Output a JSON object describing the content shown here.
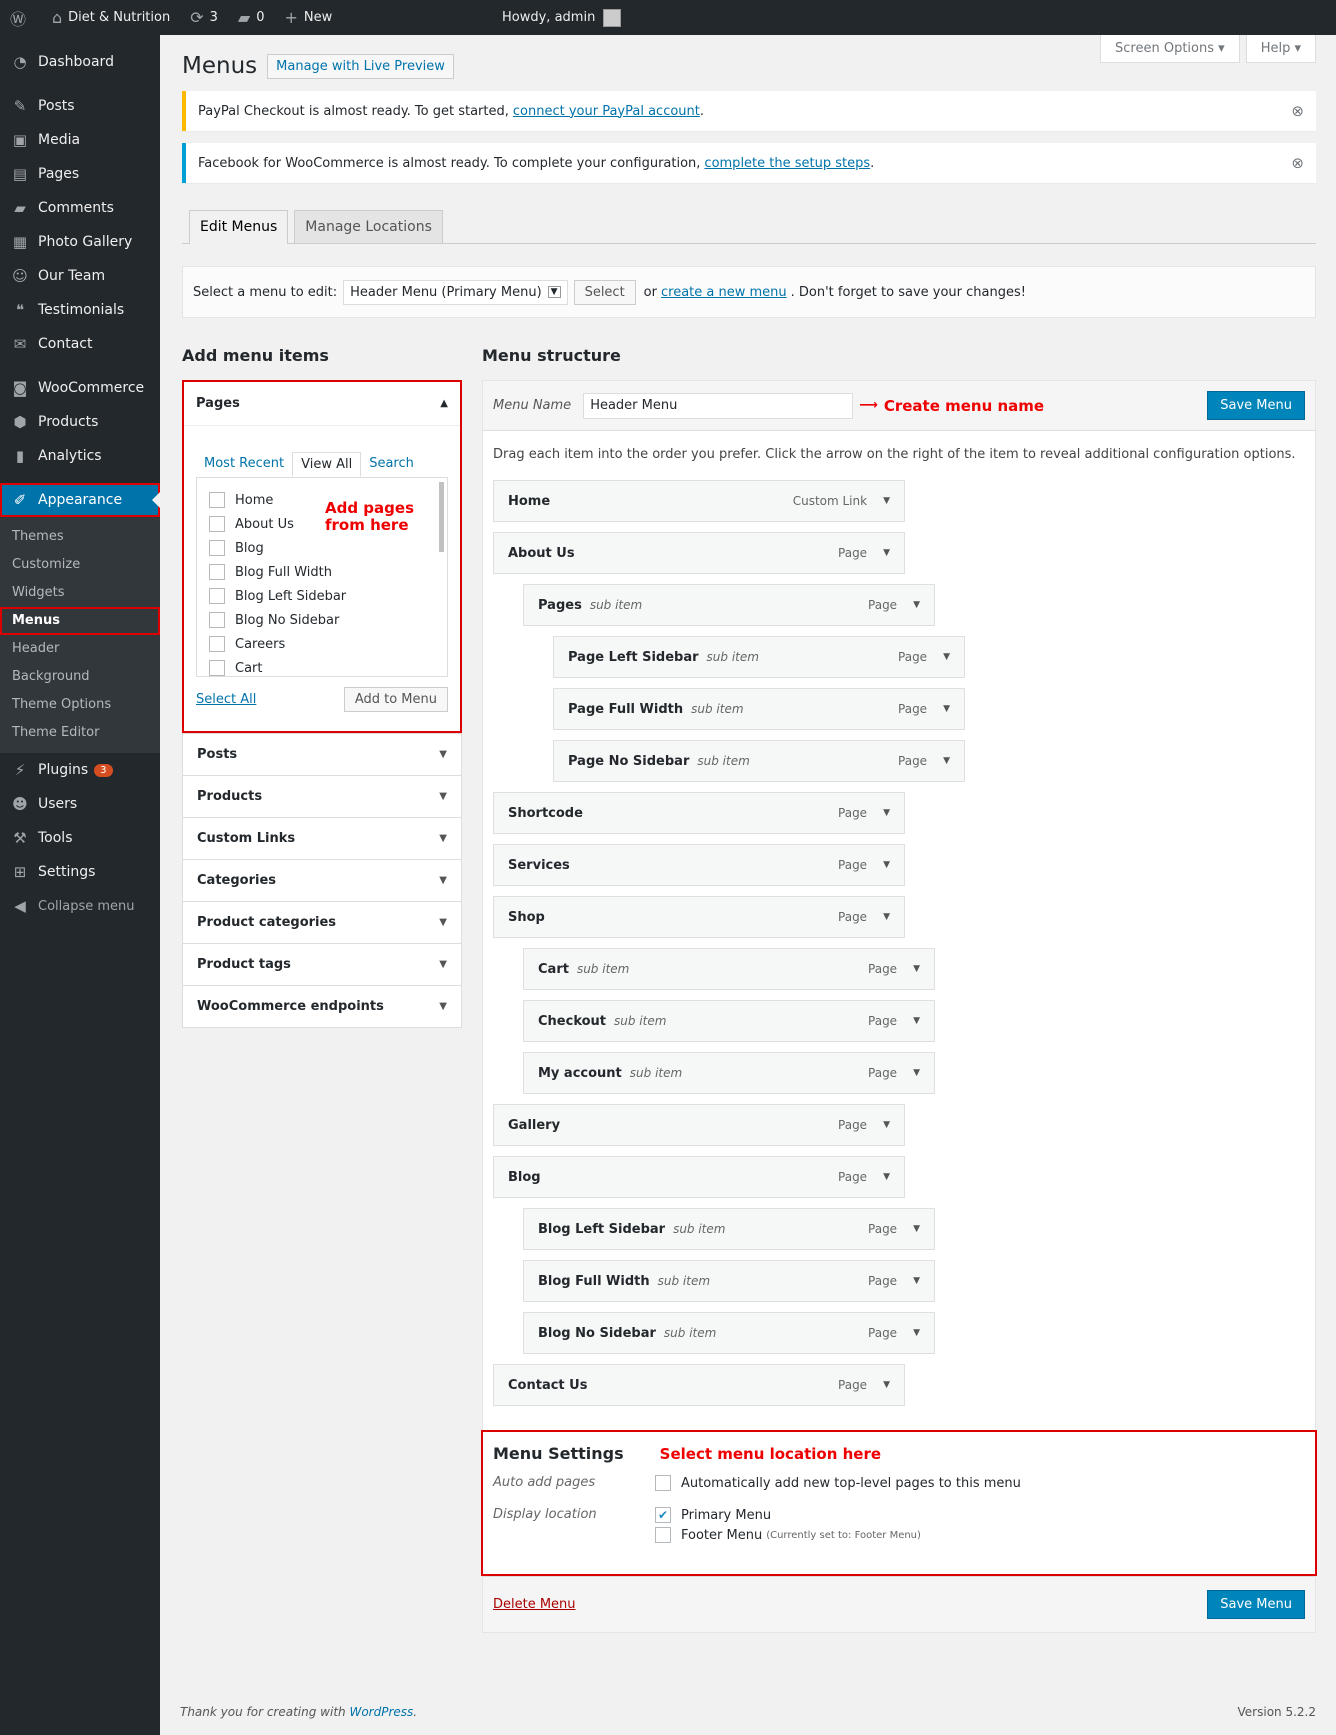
{
  "adminbar": {
    "site": "Diet & Nutrition",
    "updates": "3",
    "comments": "0",
    "new": "New",
    "howdy": "Howdy, admin"
  },
  "sidebar": {
    "items": [
      "Dashboard",
      "Posts",
      "Media",
      "Pages",
      "Comments",
      "Photo Gallery",
      "Our Team",
      "Testimonials",
      "Contact",
      "WooCommerce",
      "Products",
      "Analytics",
      "Appearance"
    ],
    "appearance_sub": [
      "Themes",
      "Customize",
      "Widgets",
      "Menus",
      "Header",
      "Background",
      "Theme Options",
      "Theme Editor"
    ],
    "bottom": [
      "Plugins",
      "Users",
      "Tools",
      "Settings",
      "Collapse menu"
    ],
    "plugins_badge": "3"
  },
  "top": {
    "screen_options": "Screen Options",
    "help": "Help"
  },
  "page": {
    "title": "Menus",
    "live_preview": "Manage with Live Preview"
  },
  "notices": [
    {
      "text": "PayPal Checkout is almost ready. To get started,",
      "link": "connect your PayPal account",
      "end": "."
    },
    {
      "text": "Facebook for WooCommerce is almost ready. To complete your configuration,",
      "link": "complete the setup steps",
      "end": "."
    }
  ],
  "tabs": {
    "edit": "Edit Menus",
    "locations": "Manage Locations"
  },
  "select_bar": {
    "label": "Select a menu to edit:",
    "value": "Header Menu (Primary Menu)",
    "button": "Select",
    "or": "or",
    "create": "create a new menu",
    "rest": ". Don't forget to save your changes!"
  },
  "add_items": {
    "title": "Add menu items",
    "pages_title": "Pages",
    "tabs": [
      "Most Recent",
      "View All",
      "Search"
    ],
    "pages": [
      "Home",
      "About Us",
      "Blog",
      "Blog Full Width",
      "Blog Left Sidebar",
      "Blog No Sidebar",
      "Careers",
      "Cart"
    ],
    "annotation": "Add pages from here",
    "select_all": "Select All",
    "add_button": "Add to Menu",
    "sections": [
      "Posts",
      "Products",
      "Custom Links",
      "Categories",
      "Product categories",
      "Product tags",
      "WooCommerce endpoints"
    ]
  },
  "structure": {
    "title": "Menu structure",
    "name_label": "Menu Name",
    "name_value": "Header Menu",
    "annotation": "Create menu name",
    "save": "Save Menu",
    "instructions": "Drag each item into the order you prefer. Click the arrow on the right of the item to reveal additional configuration options.",
    "items": [
      {
        "title": "Home",
        "sub": "",
        "type": "Custom Link",
        "depth": 0
      },
      {
        "title": "About Us",
        "sub": "",
        "type": "Page",
        "depth": 0
      },
      {
        "title": "Pages",
        "sub": "sub item",
        "type": "Page",
        "depth": 1
      },
      {
        "title": "Page Left Sidebar",
        "sub": "sub item",
        "type": "Page",
        "depth": 2
      },
      {
        "title": "Page Full Width",
        "sub": "sub item",
        "type": "Page",
        "depth": 2
      },
      {
        "title": "Page No Sidebar",
        "sub": "sub item",
        "type": "Page",
        "depth": 2
      },
      {
        "title": "Shortcode",
        "sub": "",
        "type": "Page",
        "depth": 0
      },
      {
        "title": "Services",
        "sub": "",
        "type": "Page",
        "depth": 0
      },
      {
        "title": "Shop",
        "sub": "",
        "type": "Page",
        "depth": 0
      },
      {
        "title": "Cart",
        "sub": "sub item",
        "type": "Page",
        "depth": 1
      },
      {
        "title": "Checkout",
        "sub": "sub item",
        "type": "Page",
        "depth": 1
      },
      {
        "title": "My account",
        "sub": "sub item",
        "type": "Page",
        "depth": 1
      },
      {
        "title": "Gallery",
        "sub": "",
        "type": "Page",
        "depth": 0
      },
      {
        "title": "Blog",
        "sub": "",
        "type": "Page",
        "depth": 0
      },
      {
        "title": "Blog Left Sidebar",
        "sub": "sub item",
        "type": "Page",
        "depth": 1
      },
      {
        "title": "Blog Full Width",
        "sub": "sub item",
        "type": "Page",
        "depth": 1
      },
      {
        "title": "Blog No Sidebar",
        "sub": "sub item",
        "type": "Page",
        "depth": 1
      },
      {
        "title": "Contact Us",
        "sub": "",
        "type": "Page",
        "depth": 0
      }
    ]
  },
  "settings": {
    "title": "Menu Settings",
    "annotation": "Select menu location here",
    "auto_label": "Auto add pages",
    "auto_text": "Automatically add new top-level pages to this menu",
    "display_label": "Display location",
    "primary": "Primary Menu",
    "footer": "Footer Menu",
    "footer_note": "(Currently set to: Footer Menu)",
    "delete": "Delete Menu"
  },
  "footer": {
    "thanks": "Thank you for creating with",
    "wp": "WordPress",
    "version": "Version 5.2.2"
  }
}
